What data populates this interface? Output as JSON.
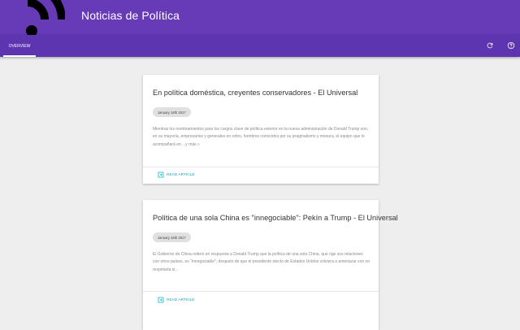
{
  "app": {
    "title": "Noticias de Política",
    "logo_icon": "rss-icon",
    "accent_color": "#673ab7",
    "link_color": "#00acc1"
  },
  "tabs": [
    {
      "label": "OVERVIEW",
      "active": true
    }
  ],
  "toolbar": {
    "refresh_icon": "refresh-icon",
    "help_icon": "help-icon"
  },
  "articles": [
    {
      "title": "En política doméstica, creyentes conservadores - El Universal",
      "date": "January 16th 2017",
      "description": "Mientras los nombramientos para los cargos clave de política exterior en la nueva administración de Donald Trump son, en su mayoría, empresarios y generales en retiro, hombres conocidos por su pragmatismo y mesura, el equipo que lo acompañará en ...y más »",
      "link_label": "READ ARTICLE",
      "link_icon": "open-in-new-icon"
    },
    {
      "title": "Política de una sola China es \"innegociable\": Pekín a Trump - El Universal",
      "date": "January 16th 2017",
      "description": "El Gobierno de China reiteró en respuesta a Donald Trump que la política de una sola China, que rige sus relaciones con otros países, es \"innegociable\", después de que el presidente electo de Estados Unidos volviera a amenazar con no respetarla si...",
      "link_label": "READ ARTICLE",
      "link_icon": "open-in-new-icon"
    }
  ]
}
